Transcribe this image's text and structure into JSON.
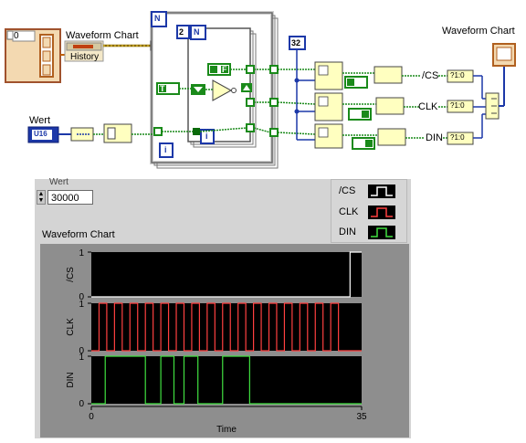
{
  "block_diagram": {
    "array_index_value": "0",
    "waveform_chart_label": "Waveform Chart",
    "history_label": "History",
    "wert_label": "Wert",
    "u16_label": "U16",
    "loop_count_outer": "N",
    "loop_count_inner_value": "2",
    "loop_count_inner": "N",
    "constant_32": "32",
    "iteration_outer": "i",
    "iteration_inner": "i",
    "bool_true": "T",
    "bool_false": "F",
    "signal_cs": "/CS",
    "signal_clk": "CLK",
    "signal_din": "DIN",
    "to_bool_label": "?1:0",
    "output_chart_label": "Waveform Chart"
  },
  "front_panel": {
    "wert_label": "Wert",
    "wert_value": "30000",
    "chart_label": "Waveform Chart",
    "legend": [
      {
        "name": "/CS",
        "color": "#ffffff"
      },
      {
        "name": "CLK",
        "color": "#ff4040"
      },
      {
        "name": "DIN",
        "color": "#40e040"
      }
    ]
  },
  "chart_data": {
    "type": "line",
    "xlabel": "Time",
    "xlim": [
      0,
      35
    ],
    "x_ticks": [
      "0",
      "35"
    ],
    "plots": [
      {
        "name": "/CS",
        "ylabel": "/CS",
        "ylim": [
          0,
          1
        ],
        "y_ticks": [
          "1",
          "0"
        ],
        "color": "#ffffff",
        "segments": [
          [
            0,
            0
          ],
          [
            33.5,
            0
          ],
          [
            33.5,
            1
          ],
          [
            35,
            1
          ]
        ]
      },
      {
        "name": "CLK",
        "ylabel": "CLK",
        "ylim": [
          0,
          1
        ],
        "y_ticks": [
          "1",
          "0"
        ],
        "color": "#ff4040",
        "pulses": 16,
        "period": 2,
        "first_rise": 1,
        "last_fall": 33
      },
      {
        "name": "DIN",
        "ylabel": "DIN",
        "ylim": [
          0,
          1
        ],
        "y_ticks": [
          "1",
          "0"
        ],
        "color": "#40e040",
        "segments": [
          [
            0,
            0
          ],
          [
            1.8,
            0
          ],
          [
            1.8,
            1
          ],
          [
            7,
            1
          ],
          [
            7,
            0
          ],
          [
            9,
            0
          ],
          [
            9,
            1
          ],
          [
            10.7,
            1
          ],
          [
            10.7,
            0
          ],
          [
            12,
            0
          ],
          [
            12,
            1
          ],
          [
            13.8,
            1
          ],
          [
            13.8,
            0
          ],
          [
            17,
            0
          ],
          [
            17,
            1
          ],
          [
            20.5,
            1
          ],
          [
            20.5,
            0
          ],
          [
            35,
            0
          ]
        ]
      }
    ]
  }
}
